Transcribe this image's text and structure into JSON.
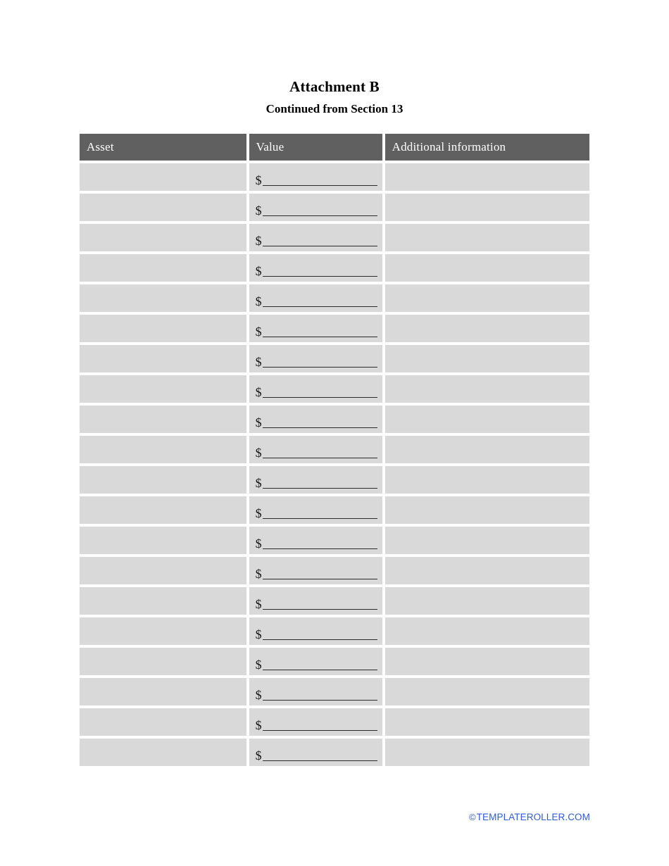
{
  "document": {
    "title": "Attachment B",
    "subtitle": "Continued from Section 13"
  },
  "table": {
    "columns": [
      {
        "key": "asset",
        "label": "Asset"
      },
      {
        "key": "value",
        "label": "Value"
      },
      {
        "key": "additional",
        "label": "Additional information"
      }
    ],
    "row_count": 20,
    "value_prefix": "$",
    "rows": [
      {
        "asset": "",
        "value": "",
        "additional": ""
      },
      {
        "asset": "",
        "value": "",
        "additional": ""
      },
      {
        "asset": "",
        "value": "",
        "additional": ""
      },
      {
        "asset": "",
        "value": "",
        "additional": ""
      },
      {
        "asset": "",
        "value": "",
        "additional": ""
      },
      {
        "asset": "",
        "value": "",
        "additional": ""
      },
      {
        "asset": "",
        "value": "",
        "additional": ""
      },
      {
        "asset": "",
        "value": "",
        "additional": ""
      },
      {
        "asset": "",
        "value": "",
        "additional": ""
      },
      {
        "asset": "",
        "value": "",
        "additional": ""
      },
      {
        "asset": "",
        "value": "",
        "additional": ""
      },
      {
        "asset": "",
        "value": "",
        "additional": ""
      },
      {
        "asset": "",
        "value": "",
        "additional": ""
      },
      {
        "asset": "",
        "value": "",
        "additional": ""
      },
      {
        "asset": "",
        "value": "",
        "additional": ""
      },
      {
        "asset": "",
        "value": "",
        "additional": ""
      },
      {
        "asset": "",
        "value": "",
        "additional": ""
      },
      {
        "asset": "",
        "value": "",
        "additional": ""
      },
      {
        "asset": "",
        "value": "",
        "additional": ""
      },
      {
        "asset": "",
        "value": "",
        "additional": ""
      }
    ]
  },
  "footer": {
    "copyright_symbol": "©",
    "text": "TEMPLATEROLLER.COM"
  },
  "colors": {
    "page_background": "#ffffff",
    "header_fill": "#606060",
    "header_text": "#ffffff",
    "cell_fill": "#d9d9d9",
    "rule_line": "#2b2b2b",
    "footer_link": "#2f5bd4",
    "body_text": "#000000"
  }
}
